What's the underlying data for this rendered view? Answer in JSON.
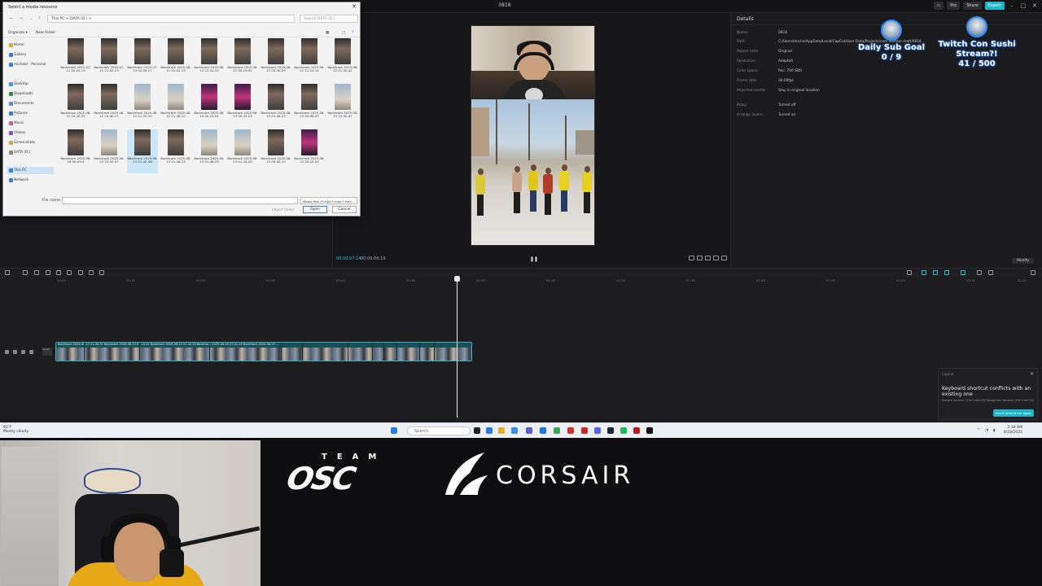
{
  "editor": {
    "title": "0818",
    "topbar": {
      "pro": "Pro",
      "share": "Share",
      "export": "Export"
    }
  },
  "preview": {
    "timecode": "00:00:07:14",
    "duration": "00:00:09:19",
    "play_icon": "pause-icon"
  },
  "details": {
    "header": "Details",
    "rows": [
      {
        "key": "Name:",
        "value": "0818"
      },
      {
        "key": "Path:",
        "value": "C:/Users/miche/AppData/Local/CapCut/User Data/Projects/com.lveditor.draft/0818"
      },
      {
        "key": "Aspect ratio:",
        "value": "Original"
      },
      {
        "key": "Resolution:",
        "value": "Adapted"
      },
      {
        "key": "Color space:",
        "value": "Rec. 709 SDR"
      },
      {
        "key": "Frame rate:",
        "value": "30.00fps"
      },
      {
        "key": "Imported media:",
        "value": "Stay in original location"
      },
      {
        "key": "Proxy:",
        "value": "Turned off"
      },
      {
        "key": "Arrange layers:",
        "value": "Turned on"
      }
    ],
    "modify": "Modify"
  },
  "goals": {
    "sub": {
      "title": "Daily Sub Goal",
      "count": "0 / 9"
    },
    "sushi": {
      "title": "Twitch Con Sushi Stream?!",
      "count": "41 / 500"
    }
  },
  "timeline": {
    "ticks": [
      "00:00",
      "00:10",
      "00:20",
      "00:30",
      "00:40",
      "00:50",
      "01:00",
      "01:10",
      "01:20",
      "01:30",
      "01:40",
      "01:50",
      "02:00",
      "02:10",
      "02:20"
    ],
    "clip_label": "Backtrack 2025-08-13 01-06-31   Backtrack 2025-08-13 01-10-51   Backtrack 2025-08-13 01-42-33   Backtrack 2025-08-18 07-41-19   Backtrack 2025-08-13 ...",
    "cover": "Cover"
  },
  "toast": {
    "app": "CapCut",
    "title": "Keyboard shortcut conflicts with an existing one",
    "body": "Record screen: [Ctrl+Alt+R] Snap/hide record: [Ctrl+Alt+S]",
    "button": "Don't remind me again"
  },
  "dialog": {
    "title": "Select a media resource",
    "address": "This PC  >  DATA (D:)  >",
    "search_placeholder": "Search DATA (D:)",
    "organize": "Organize ▾",
    "new_folder": "New folder",
    "nav": [
      {
        "label": "Home",
        "color": "#d9a440"
      },
      {
        "label": "Gallery",
        "color": "#3b7ed8"
      },
      {
        "label": "michael - Personal",
        "color": "#3b7ed8"
      },
      {
        "label": "Desktop",
        "color": "#3b9bd8"
      },
      {
        "label": "Downloads",
        "color": "#2b8f3a"
      },
      {
        "label": "Documents",
        "color": "#5a8fd0"
      },
      {
        "label": "Pictures",
        "color": "#3b7ed8"
      },
      {
        "label": "Music",
        "color": "#d05a8a"
      },
      {
        "label": "Videos",
        "color": "#7b4fd0"
      },
      {
        "label": "Screenshots",
        "color": "#d9a440"
      },
      {
        "label": "DATA (D:)",
        "color": "#888888"
      },
      {
        "label": "This PC",
        "color": "#3b7ed8"
      },
      {
        "label": "Network",
        "color": "#3b7ed8"
      }
    ],
    "files": [
      {
        "name": "Backtrack 2025-07-11 20-10-13",
        "style": "dark"
      },
      {
        "name": "Backtrack 2025-07-11 21-02-13",
        "style": "dark"
      },
      {
        "name": "Backtrack 2025-07-13 02-05-17",
        "style": "dark"
      },
      {
        "name": "Backtrack 2025-08-11 22-02-13",
        "style": "dark"
      },
      {
        "name": "Backtrack 2025-08-12 22-42-10",
        "style": "dark"
      },
      {
        "name": "Backtrack 2025-08-11 00-19-00",
        "style": "dark"
      },
      {
        "name": "Backtrack 2025-08-11 00-30-23",
        "style": "dark"
      },
      {
        "name": "Backtrack 2025-08-11 21-10-19",
        "style": "dark"
      },
      {
        "name": "Backtrack 2025-08-12 01-00-42",
        "style": "dark"
      },
      {
        "name": "Backtrack 2025-08-12 19-40-25",
        "style": "dark"
      },
      {
        "name": "Backtrack 2025-08-12 19-40-27",
        "style": "dark"
      },
      {
        "name": "Backtrack 2025-08-12 21-20-31",
        "style": "light"
      },
      {
        "name": "Backtrack 2025-08-12 21-48-12",
        "style": "dark"
      },
      {
        "name": "Backtrack 2025-08-13 00-10-04",
        "style": "pink"
      },
      {
        "name": "Backtrack 2025-08-13 00-43-23",
        "style": "dark"
      },
      {
        "name": "Backtrack 2025-08-13 01-06-23",
        "style": "light"
      },
      {
        "name": "Backtrack 2025-08-13 00-08-43",
        "style": "dark"
      },
      {
        "name": "Backtrack 2025-08-13 15-50-47",
        "style": "light"
      },
      {
        "name": "Backtrack 2025-08-18 00-09-4",
        "style": "dark"
      },
      {
        "name": "Backtrack 2025-08-13 15-50-47",
        "style": "dark"
      },
      {
        "name": "Backtrack 2025-08-13 01-42-48",
        "style": "dark"
      },
      {
        "name": "Backtrack 2025-08-13 01-46-23",
        "style": "light"
      },
      {
        "name": "Backtrack 2025-08-13 01-46-29",
        "style": "light"
      },
      {
        "name": "Backtrack 2025-08-13 01-10-20",
        "style": "dark"
      },
      {
        "name": "Backtrack 2025-08-13 09-40-13",
        "style": "light"
      },
      {
        "name": "Backtrack 2025-08-13 20-10-23",
        "style": "dark"
      }
    ],
    "filename_label": "File name:",
    "filter": "Media files (*.mp4;*.mov;*.mkv...",
    "import_folder": "Import folder",
    "open": "Open",
    "cancel": "Cancel"
  },
  "taskbar": {
    "weather_temp": "91°F",
    "weather_desc": "Mostly cloudy",
    "search": "Search",
    "time": "2:18 AM",
    "date": "8/18/2025"
  },
  "stream": {
    "team": "TEAM",
    "osc": "OSC",
    "corsair": "CORSAIR"
  }
}
